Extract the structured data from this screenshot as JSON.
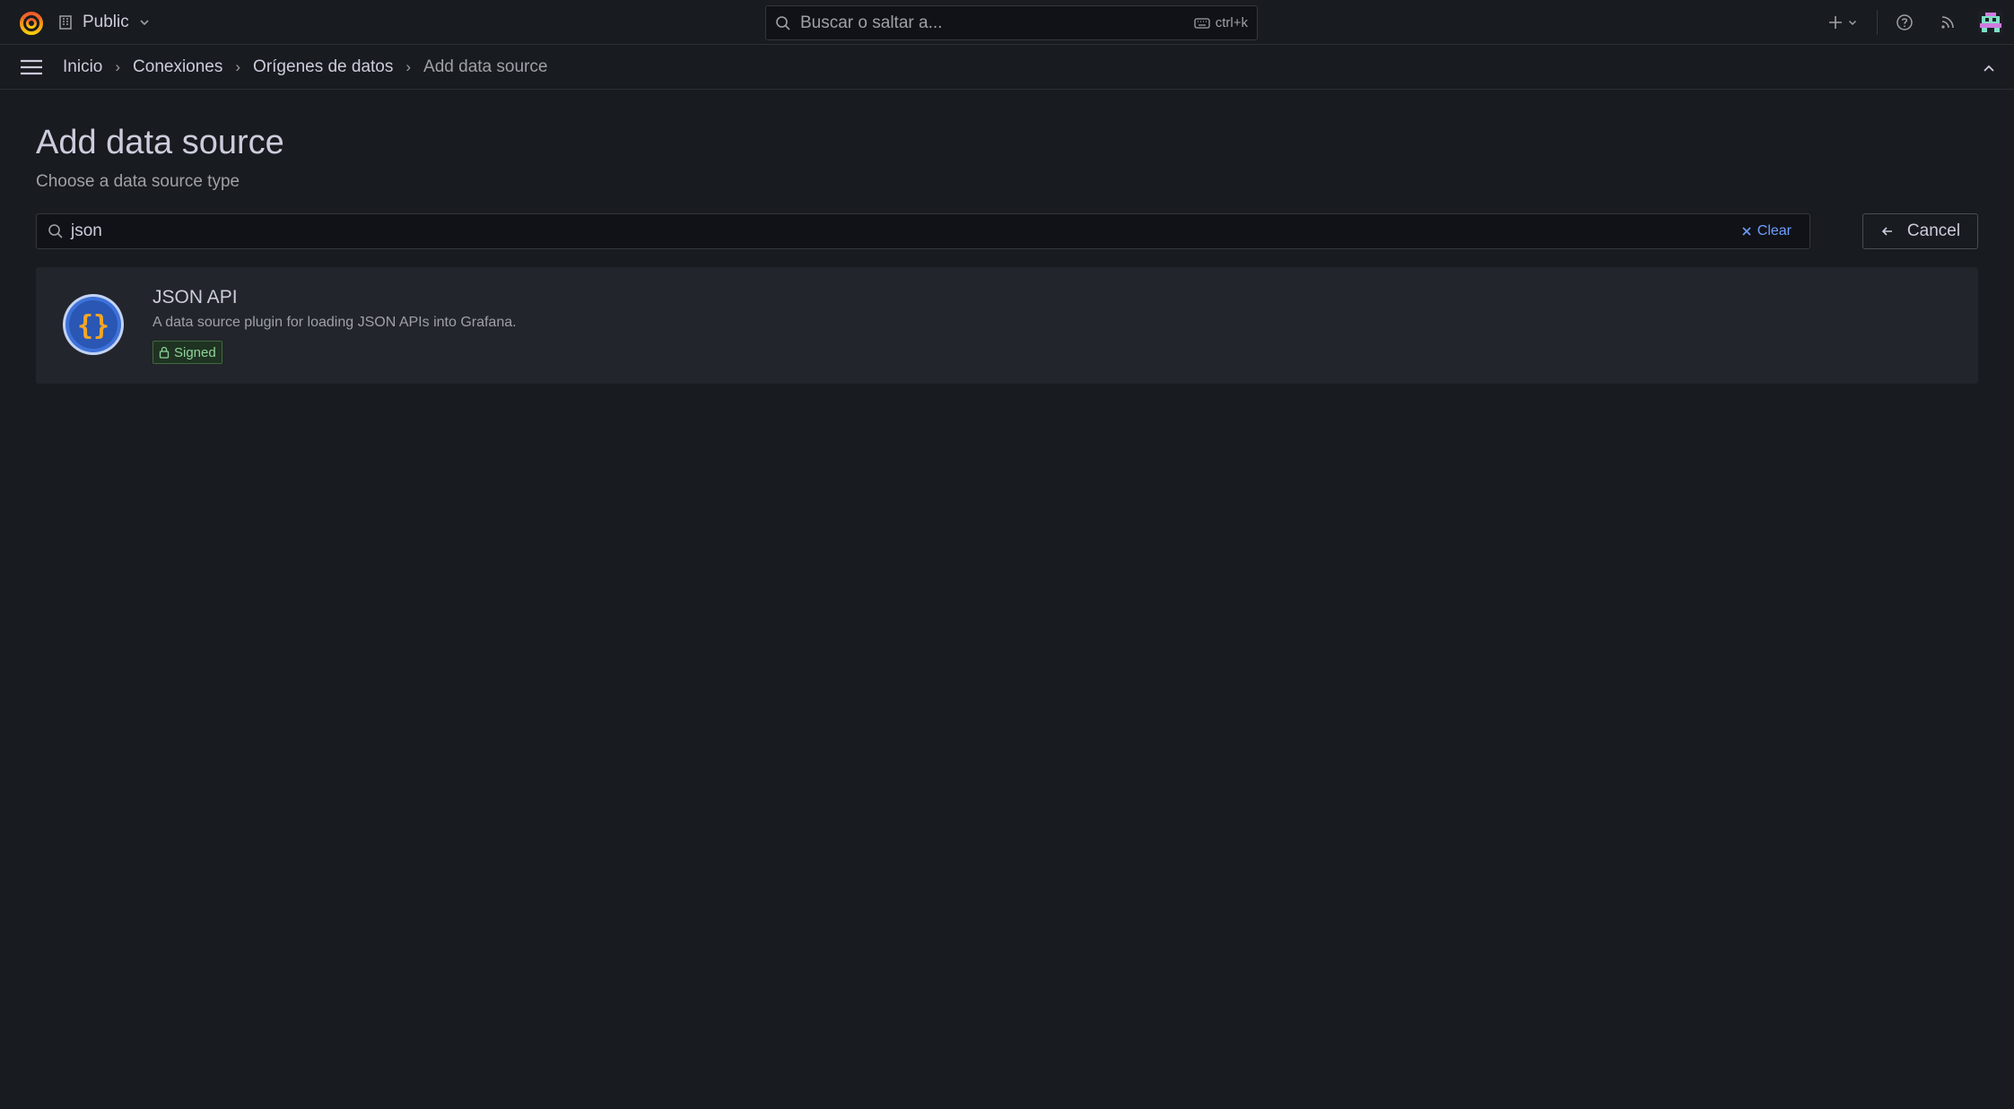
{
  "topbar": {
    "org_name": "Public",
    "search_placeholder": "Buscar o saltar a...",
    "search_shortcut": "ctrl+k"
  },
  "breadcrumb": {
    "items": [
      "Inicio",
      "Conexiones",
      "Orígenes de datos",
      "Add data source"
    ],
    "separator": "›"
  },
  "page": {
    "title": "Add data source",
    "subtitle": "Choose a data source type"
  },
  "filter": {
    "value": "json",
    "clear_label": "Clear"
  },
  "cancel_label": "Cancel",
  "results": [
    {
      "name": "JSON API",
      "description": "A data source plugin for loading JSON APIs into Grafana.",
      "badge": "Signed",
      "logo_text": "{}"
    }
  ],
  "colors": {
    "background": "#181b1f",
    "card": "#22252b",
    "accent_link": "#6e9fff",
    "signed_green": "#8fd49a",
    "plugin_blue": "#3d71d9",
    "plugin_orange": "#f5a623"
  }
}
